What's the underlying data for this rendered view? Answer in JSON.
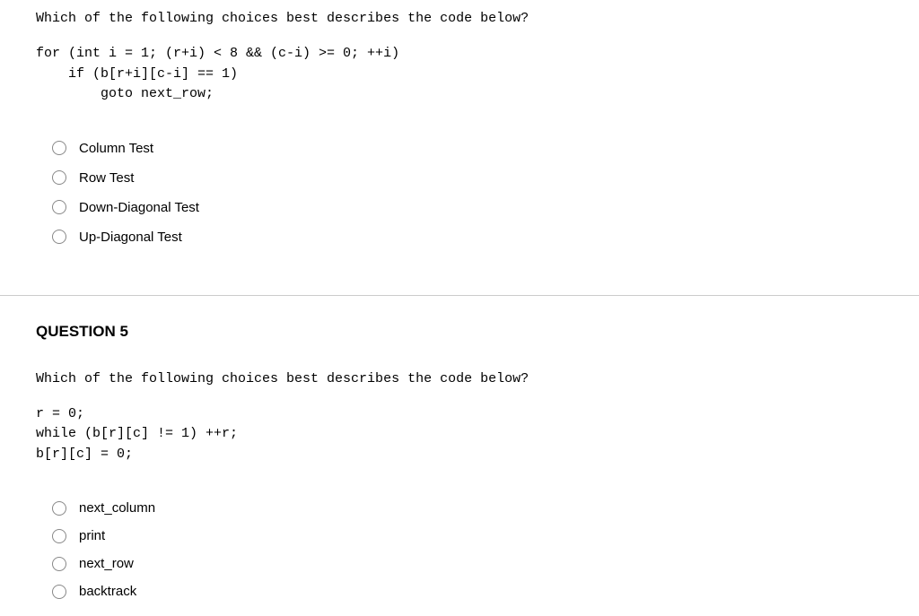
{
  "question4": {
    "prompt": "Which of the following choices best describes the code below?",
    "code": "for (int i = 1; (r+i) < 8 && (c-i) >= 0; ++i)\n    if (b[r+i][c-i] == 1)\n        goto next_row;",
    "options": [
      "Column Test",
      "Row Test",
      "Down-Diagonal Test",
      "Up-Diagonal Test"
    ]
  },
  "question5": {
    "heading": "QUESTION 5",
    "prompt": "Which of the following choices best describes the code below?",
    "code": "r = 0;\nwhile (b[r][c] != 1) ++r;\nb[r][c] = 0;",
    "options": [
      "next_column",
      "print",
      "next_row",
      "backtrack"
    ]
  }
}
